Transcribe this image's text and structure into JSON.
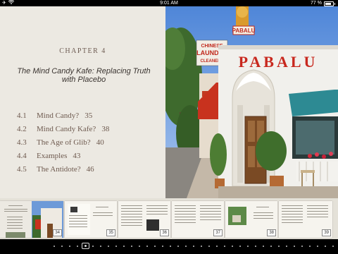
{
  "status_bar": {
    "time": "9:01 AM",
    "battery": "77 %",
    "icons": [
      "airplane-icon",
      "wifi-icon",
      "battery-icon"
    ]
  },
  "page": {
    "chapter": "CHAPTER 4",
    "title": "The Mind Candy Kafe: Replacing Truth with Placebo",
    "toc": [
      {
        "num": "4.1",
        "name": "Mind Candy?",
        "page": "35"
      },
      {
        "num": "4.2",
        "name": "Mind Candy Kafe?",
        "page": "38"
      },
      {
        "num": "4.3",
        "name": "The Age of Glib?",
        "page": "40"
      },
      {
        "num": "4.4",
        "name": "Examples",
        "page": "43"
      },
      {
        "num": "4.5",
        "name": "The Antidote?",
        "page": "46"
      }
    ]
  },
  "photo": {
    "signs": [
      "PABALU",
      "CHINESE",
      "LAUNDRY",
      "CLEANERS"
    ]
  },
  "thumbnails": [
    {
      "page": "34"
    },
    {
      "page": "35"
    },
    {
      "page": "36"
    },
    {
      "page": "37"
    },
    {
      "page": "38"
    },
    {
      "page": "39"
    }
  ],
  "page_scrubber": {
    "total_dots": 37,
    "active_index": 4
  }
}
